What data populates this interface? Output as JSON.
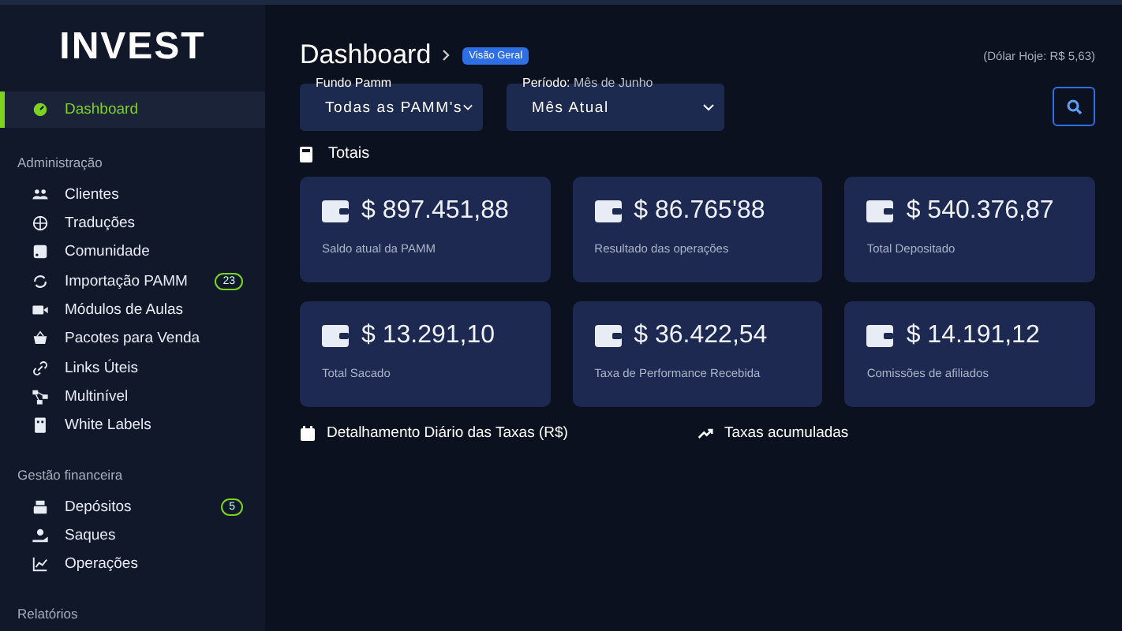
{
  "sidebar": {
    "logo": "INVEST",
    "items": [
      {
        "label": "Dashboard",
        "selected": true
      }
    ],
    "sections": [
      {
        "title": "Administração",
        "items": [
          {
            "label": "Clientes"
          },
          {
            "label": "Traduções"
          },
          {
            "label": "Comunidade"
          },
          {
            "label": "Importação PAMM",
            "badge": "23"
          },
          {
            "label": "Módulos de Aulas"
          },
          {
            "label": "Pacotes para Venda"
          },
          {
            "label": "Links Úteis"
          },
          {
            "label": "Multinível"
          },
          {
            "label": "White Labels"
          }
        ]
      },
      {
        "title": "Gestão financeira",
        "items": [
          {
            "label": "Depósitos",
            "badge": "5"
          },
          {
            "label": "Saques"
          },
          {
            "label": "Operações"
          }
        ]
      },
      {
        "title": "Relatórios"
      }
    ]
  },
  "header": {
    "title": "Dashboard",
    "breadcrumb": "Visão Geral",
    "rate": "(Dólar Hoje: R$ 5,63)"
  },
  "filters": [
    {
      "label": "Fundo Pamm",
      "value": "Todas as PAMM's"
    },
    {
      "label": "Período:",
      "hint": "Mês de Junho",
      "value": "Mês Atual"
    }
  ],
  "totals": {
    "title": "Totais",
    "cards": [
      {
        "value": "$ 897.451,88",
        "label": "Saldo atual da PAMM"
      },
      {
        "value": "$ 86.765'88",
        "label": "Resultado das operações"
      },
      {
        "value": "$ 540.376,87",
        "label": "Total Depositado"
      },
      {
        "value": "$ 13.291,10",
        "label": "Total Sacado"
      },
      {
        "value": "$ 36.422,54",
        "label": "Taxa de Performance Recebida"
      },
      {
        "value": "$ 14.191,12",
        "label": "Comissões de afiliados"
      }
    ]
  },
  "sections": [
    {
      "kind": "calendar",
      "title": "Detalhamento Diário das Taxas (R$)"
    },
    {
      "kind": "trend",
      "title": "Taxas acumuladas"
    }
  ]
}
